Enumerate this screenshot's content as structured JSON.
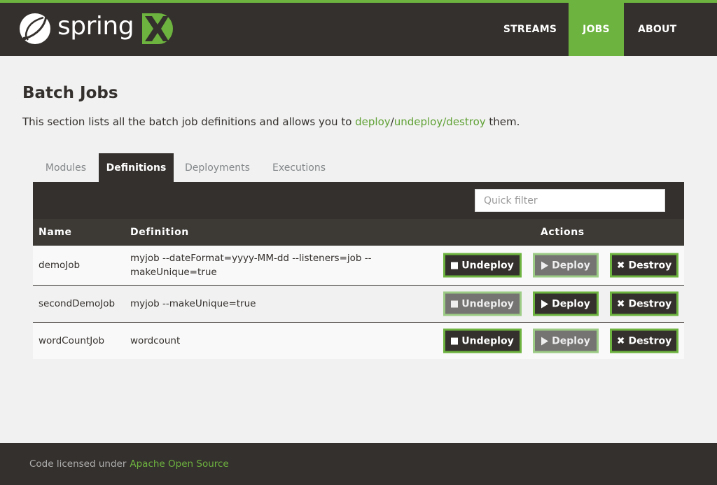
{
  "header": {
    "brand_text": "spring",
    "brand_colors": {
      "green": "#6db33f",
      "dark": "#34302d"
    },
    "nav": [
      {
        "label": "STREAMS",
        "active": false
      },
      {
        "label": "JOBS",
        "active": true
      },
      {
        "label": "ABOUT",
        "active": false
      }
    ]
  },
  "page": {
    "title": "Batch Jobs",
    "description_prefix": "This section lists all the batch job definitions and allows you to ",
    "link_deploy": "deploy",
    "sep1": "/",
    "link_undeploy": "undeploy",
    "sep2": "/",
    "link_destroy": "destroy",
    "description_suffix": " them."
  },
  "tabs": [
    {
      "label": "Modules",
      "active": false
    },
    {
      "label": "Definitions",
      "active": true
    },
    {
      "label": "Deployments",
      "active": false
    },
    {
      "label": "Executions",
      "active": false
    }
  ],
  "filter": {
    "placeholder": "Quick filter",
    "value": ""
  },
  "table": {
    "columns": [
      "Name",
      "Definition",
      "Actions"
    ],
    "rows": [
      {
        "name": "demoJob",
        "definition": "myjob --dateFormat=yyyy-MM-dd --listeners=job --makeUnique=true",
        "undeploy": {
          "label": "Undeploy",
          "enabled": true
        },
        "deploy": {
          "label": "Deploy",
          "enabled": false
        },
        "destroy": {
          "label": "Destroy",
          "enabled": true
        }
      },
      {
        "name": "secondDemoJob",
        "definition": "myjob --makeUnique=true",
        "undeploy": {
          "label": "Undeploy",
          "enabled": false
        },
        "deploy": {
          "label": "Deploy",
          "enabled": true
        },
        "destroy": {
          "label": "Destroy",
          "enabled": true
        }
      },
      {
        "name": "wordCountJob",
        "definition": "wordcount",
        "undeploy": {
          "label": "Undeploy",
          "enabled": true
        },
        "deploy": {
          "label": "Deploy",
          "enabled": false
        },
        "destroy": {
          "label": "Destroy",
          "enabled": true
        }
      }
    ]
  },
  "footer": {
    "text": "Code licensed under",
    "link": "Apache Open Source"
  }
}
